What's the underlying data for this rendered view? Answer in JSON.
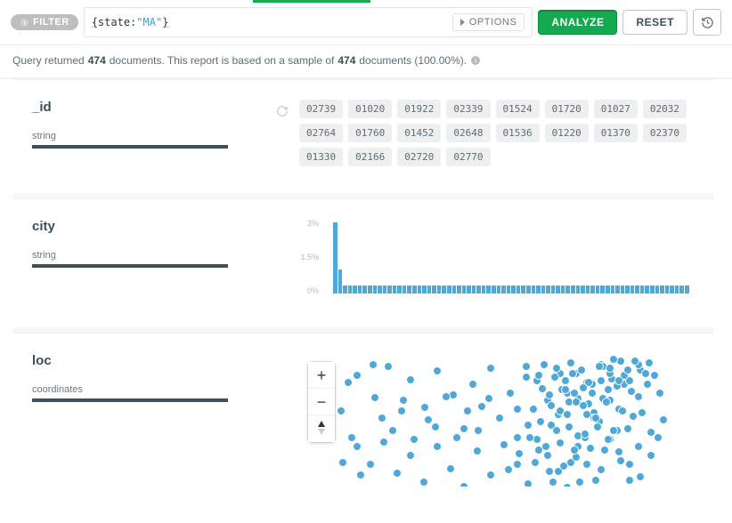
{
  "filter": {
    "badge_label": "FILTER",
    "query_key": "state",
    "query_value": "\"MA\"",
    "options_label": "OPTIONS"
  },
  "actions": {
    "analyze": "ANALYZE",
    "reset": "RESET"
  },
  "status": {
    "prefix": "Query returned ",
    "count": "474",
    "mid": " documents. This report is based on a sample of ",
    "sample": "474",
    "suffix": " documents (100.00%). "
  },
  "fields": {
    "id": {
      "name": "_id",
      "type": "string",
      "chips": [
        "02739",
        "01020",
        "01922",
        "02339",
        "01524",
        "01720",
        "01027",
        "02032",
        "02764",
        "01760",
        "01452",
        "02648",
        "01536",
        "01220",
        "01370",
        "02370",
        "01330",
        "02166",
        "02720",
        "02770"
      ]
    },
    "city": {
      "name": "city",
      "type": "string"
    },
    "loc": {
      "name": "loc",
      "type": "coordinates"
    }
  },
  "chart_data": {
    "type": "bar",
    "title": "",
    "xlabel": "",
    "ylabel": "",
    "ylim": [
      0,
      3
    ],
    "y_ticks": [
      "3%",
      "1.5%",
      "0%"
    ],
    "categories_note": "~72 distinct city values (labels not shown on axis)",
    "values_percent": [
      3.0,
      1.0,
      0.35,
      0.35,
      0.35,
      0.35,
      0.35,
      0.35,
      0.35,
      0.35,
      0.35,
      0.35,
      0.35,
      0.35,
      0.35,
      0.35,
      0.35,
      0.35,
      0.35,
      0.35,
      0.35,
      0.35,
      0.35,
      0.35,
      0.35,
      0.35,
      0.35,
      0.35,
      0.35,
      0.35,
      0.35,
      0.35,
      0.35,
      0.35,
      0.35,
      0.35,
      0.35,
      0.35,
      0.35,
      0.35,
      0.35,
      0.35,
      0.35,
      0.35,
      0.35,
      0.35,
      0.35,
      0.35,
      0.35,
      0.35,
      0.35,
      0.35,
      0.35,
      0.35,
      0.35,
      0.35,
      0.35,
      0.35,
      0.35,
      0.35,
      0.35,
      0.35,
      0.35,
      0.35,
      0.35,
      0.35,
      0.35,
      0.35,
      0.35,
      0.35,
      0.35,
      0.35
    ]
  },
  "map": {
    "zoom_in": "+",
    "zoom_out": "−",
    "reset_bearing": "▲▼",
    "points": [
      [
        60,
        20
      ],
      [
        80,
        45
      ],
      [
        95,
        10
      ],
      [
        110,
        60
      ],
      [
        120,
        25
      ],
      [
        140,
        70
      ],
      [
        150,
        15
      ],
      [
        168,
        42
      ],
      [
        180,
        80
      ],
      [
        190,
        30
      ],
      [
        200,
        55
      ],
      [
        210,
        12
      ],
      [
        220,
        68
      ],
      [
        232,
        40
      ],
      [
        240,
        90
      ],
      [
        250,
        22
      ],
      [
        258,
        58
      ],
      [
        268,
        35
      ],
      [
        278,
        76
      ],
      [
        288,
        18
      ],
      [
        298,
        50
      ],
      [
        308,
        88
      ],
      [
        318,
        28
      ],
      [
        326,
        62
      ],
      [
        334,
        8
      ],
      [
        344,
        48
      ],
      [
        352,
        82
      ],
      [
        360,
        30
      ],
      [
        370,
        66
      ],
      [
        378,
        14
      ],
      [
        60,
        100
      ],
      [
        75,
        120
      ],
      [
        90,
        95
      ],
      [
        105,
        130
      ],
      [
        120,
        110
      ],
      [
        135,
        140
      ],
      [
        150,
        100
      ],
      [
        165,
        125
      ],
      [
        180,
        145
      ],
      [
        195,
        105
      ],
      [
        210,
        132
      ],
      [
        225,
        98
      ],
      [
        240,
        120
      ],
      [
        252,
        142
      ],
      [
        264,
        104
      ],
      [
        276,
        128
      ],
      [
        288,
        96
      ],
      [
        300,
        118
      ],
      [
        310,
        140
      ],
      [
        322,
        102
      ],
      [
        334,
        126
      ],
      [
        344,
        92
      ],
      [
        356,
        116
      ],
      [
        366,
        138
      ],
      [
        376,
        100
      ],
      [
        250,
        10
      ],
      [
        262,
        26
      ],
      [
        274,
        48
      ],
      [
        286,
        64
      ],
      [
        296,
        40
      ],
      [
        306,
        18
      ],
      [
        320,
        52
      ],
      [
        332,
        72
      ],
      [
        342,
        36
      ],
      [
        354,
        58
      ],
      [
        364,
        80
      ],
      [
        376,
        44
      ],
      [
        88,
        68
      ],
      [
        100,
        82
      ],
      [
        112,
        48
      ],
      [
        124,
        92
      ],
      [
        136,
        56
      ],
      [
        148,
        78
      ],
      [
        160,
        44
      ],
      [
        172,
        90
      ],
      [
        184,
        60
      ],
      [
        196,
        82
      ],
      [
        208,
        46
      ],
      [
        42,
        60
      ],
      [
        50,
        28
      ],
      [
        54,
        90
      ],
      [
        64,
        132
      ],
      [
        44,
        118
      ],
      [
        78,
        8
      ],
      [
        240,
        58
      ],
      [
        252,
        76
      ],
      [
        264,
        20
      ],
      [
        276,
        42
      ],
      [
        288,
        60
      ],
      [
        298,
        78
      ],
      [
        308,
        100
      ],
      [
        318,
        120
      ],
      [
        328,
        138
      ],
      [
        338,
        104
      ],
      [
        348,
        82
      ],
      [
        358,
        60
      ],
      [
        368,
        38
      ],
      [
        380,
        62
      ],
      [
        390,
        84
      ],
      [
        262,
        92
      ],
      [
        274,
        110
      ],
      [
        286,
        128
      ],
      [
        296,
        146
      ],
      [
        306,
        112
      ],
      [
        316,
        90
      ],
      [
        326,
        68
      ],
      [
        336,
        46
      ],
      [
        346,
        24
      ],
      [
        356,
        4
      ],
      [
        366,
        26
      ],
      [
        376,
        8
      ],
      [
        386,
        30
      ],
      [
        300,
        6
      ],
      [
        312,
        14
      ],
      [
        324,
        30
      ],
      [
        336,
        10
      ],
      [
        348,
        2
      ],
      [
        360,
        20
      ],
      [
        372,
        4
      ],
      [
        384,
        18
      ],
      [
        260,
        118
      ],
      [
        272,
        100
      ],
      [
        284,
        82
      ],
      [
        296,
        64
      ],
      [
        308,
        46
      ],
      [
        320,
        28
      ],
      [
        332,
        10
      ],
      [
        344,
        18
      ],
      [
        280,
        140
      ],
      [
        292,
        122
      ],
      [
        304,
        104
      ],
      [
        316,
        86
      ],
      [
        328,
        68
      ],
      [
        340,
        50
      ],
      [
        352,
        32
      ],
      [
        364,
        14
      ],
      [
        230,
        126
      ],
      [
        242,
        108
      ],
      [
        254,
        90
      ],
      [
        266,
        72
      ],
      [
        278,
        54
      ],
      [
        290,
        36
      ],
      [
        302,
        18
      ],
      [
        314,
        34
      ],
      [
        284,
        12
      ],
      [
        294,
        26
      ],
      [
        304,
        40
      ],
      [
        314,
        54
      ],
      [
        324,
        40
      ],
      [
        334,
        26
      ],
      [
        344,
        12
      ],
      [
        354,
        26
      ],
      [
        270,
        8
      ],
      [
        282,
        22
      ],
      [
        294,
        36
      ],
      [
        306,
        50
      ],
      [
        318,
        64
      ],
      [
        330,
        78
      ],
      [
        342,
        92
      ],
      [
        354,
        106
      ],
      [
        366,
        120
      ],
      [
        378,
        134
      ],
      [
        390,
        110
      ],
      [
        398,
        90
      ],
      [
        404,
        70
      ],
      [
        400,
        40
      ],
      [
        394,
        20
      ],
      [
        388,
        6
      ]
    ]
  }
}
